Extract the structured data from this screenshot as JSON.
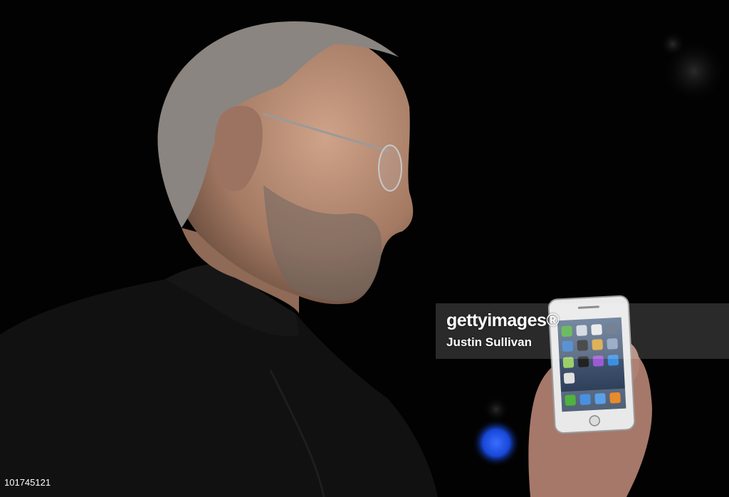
{
  "watermark": {
    "brand": "gettyimages®",
    "credit": "Justin Sullivan"
  },
  "image_id": "101745121",
  "colors": {
    "background": "#020202",
    "shirt": "#111111",
    "skin": "#b88d74",
    "hair": "#8a8580",
    "phone_frame": "#e9e9e9",
    "screen": "#2a3c56",
    "stage_light": "#1747d6"
  },
  "phone_screen": {
    "dock_icons": [
      "phone-icon",
      "mail-icon",
      "safari-icon",
      "ipod-icon"
    ]
  }
}
